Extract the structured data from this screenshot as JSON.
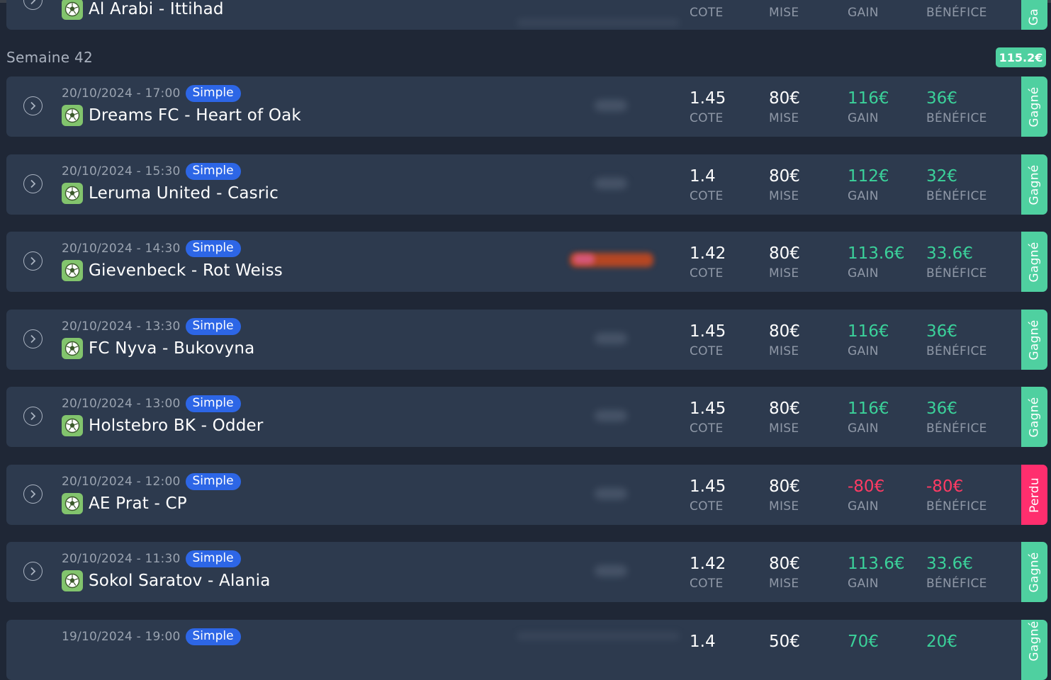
{
  "stat_labels": {
    "cote": "COTE",
    "mise": "MISE",
    "gain": "GAIN",
    "benefice": "BÉNÉFICE"
  },
  "top_card": {
    "title": "Al Arabi - Ittihad",
    "status": "Ga"
  },
  "week": {
    "label": "Semaine 42",
    "total": "115.2€"
  },
  "bets": [
    {
      "datetime": "20/10/2024 - 17:00",
      "type": "Simple",
      "match": "Dreams FC - Heart of Oak",
      "cote": "1.45",
      "mise": "80€",
      "gain": "116€",
      "benefice": "36€",
      "status": "Gagné",
      "result": "won"
    },
    {
      "datetime": "20/10/2024 - 15:30",
      "type": "Simple",
      "match": "Leruma United - Casric",
      "cote": "1.4",
      "mise": "80€",
      "gain": "112€",
      "benefice": "32€",
      "status": "Gagné",
      "result": "won"
    },
    {
      "datetime": "20/10/2024 - 14:30",
      "type": "Simple",
      "match": "Gievenbeck - Rot Weiss",
      "cote": "1.42",
      "mise": "80€",
      "gain": "113.6€",
      "benefice": "33.6€",
      "status": "Gagné",
      "result": "won"
    },
    {
      "datetime": "20/10/2024 - 13:30",
      "type": "Simple",
      "match": "FC Nyva - Bukovyna",
      "cote": "1.45",
      "mise": "80€",
      "gain": "116€",
      "benefice": "36€",
      "status": "Gagné",
      "result": "won"
    },
    {
      "datetime": "20/10/2024 - 13:00",
      "type": "Simple",
      "match": "Holstebro BK - Odder",
      "cote": "1.45",
      "mise": "80€",
      "gain": "116€",
      "benefice": "36€",
      "status": "Gagné",
      "result": "won"
    },
    {
      "datetime": "20/10/2024 - 12:00",
      "type": "Simple",
      "match": "AE Prat - CP",
      "cote": "1.45",
      "mise": "80€",
      "gain": "-80€",
      "benefice": "-80€",
      "status": "Perdu",
      "result": "lost"
    },
    {
      "datetime": "20/10/2024 - 11:30",
      "type": "Simple",
      "match": "Sokol Saratov - Alania",
      "cote": "1.42",
      "mise": "80€",
      "gain": "113.6€",
      "benefice": "33.6€",
      "status": "Gagné",
      "result": "won"
    }
  ],
  "bottom_card": {
    "datetime": "19/10/2024 - 19:00",
    "type": "Simple",
    "cote": "1.4",
    "mise": "50€",
    "gain": "70€",
    "benefice": "20€",
    "status": "Gagné"
  },
  "colors": {
    "background": "#1f2736",
    "card": "#2d3a4e",
    "badge": "#2d66e6",
    "won": "#4fd0a0",
    "lost": "#ff2e6e",
    "gain_text": "#3bd19a",
    "loss_text": "#ff3b64"
  },
  "icons": {
    "expand": "chevron-right-circle-icon",
    "sport": "soccer-ball-icon"
  }
}
